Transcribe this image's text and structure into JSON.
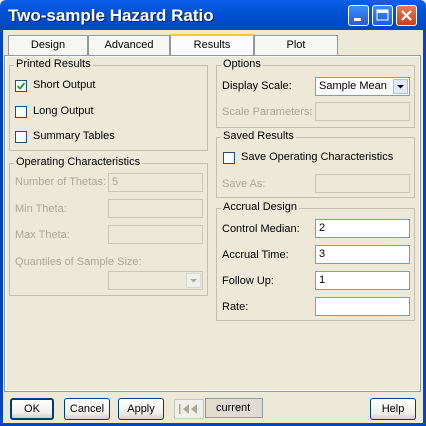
{
  "window": {
    "title": "Two-sample Hazard Ratio"
  },
  "tabs": [
    {
      "label": "Design"
    },
    {
      "label": "Advanced"
    },
    {
      "label": "Results"
    },
    {
      "label": "Plot"
    }
  ],
  "active_tab": "Results",
  "printed_results": {
    "title": "Printed Results",
    "short_output": {
      "label": "Short Output",
      "checked": true
    },
    "long_output": {
      "label": "Long Output",
      "checked": false
    },
    "summary_tables": {
      "label": "Summary Tables",
      "checked": false
    }
  },
  "operating_characteristics": {
    "title": "Operating Characteristics",
    "number_of_thetas": {
      "label": "Number of Thetas:",
      "value": "5"
    },
    "min_theta": {
      "label": "Min Theta:",
      "value": ""
    },
    "max_theta": {
      "label": "Max Theta:",
      "value": ""
    },
    "quantiles": {
      "label": "Quantiles of Sample Size:",
      "value": ""
    }
  },
  "options": {
    "title": "Options",
    "display_scale": {
      "label": "Display Scale:",
      "value": "Sample Mean"
    },
    "scale_parameters": {
      "label": "Scale Parameters:",
      "value": ""
    }
  },
  "saved_results": {
    "title": "Saved Results",
    "save_oc": {
      "label": "Save Operating Characteristics",
      "checked": false
    },
    "save_as": {
      "label": "Save As:",
      "value": ""
    }
  },
  "accrual_design": {
    "title": "Accrual Design",
    "control_median": {
      "label": "Control Median:",
      "value": "2"
    },
    "accrual_time": {
      "label": "Accrual Time:",
      "value": "3"
    },
    "follow_up": {
      "label": "Follow Up:",
      "value": "1"
    },
    "rate": {
      "label": "Rate:",
      "value": ""
    }
  },
  "footer": {
    "ok": "OK",
    "cancel": "Cancel",
    "apply": "Apply",
    "current": "current",
    "help": "Help"
  },
  "icons": {
    "minimize": "minimize-icon",
    "maximize": "maximize-icon",
    "close": "close-icon",
    "dropdown": "chevron-down-icon",
    "nav_prev": "nav-prev-icon",
    "checkmark": "checkmark-icon"
  },
  "colors": {
    "titlebar": "#0052D6",
    "dialog_bg": "#ECE9D8",
    "tab_highlight": "#FFC83C",
    "close_button": "#C8401A"
  }
}
